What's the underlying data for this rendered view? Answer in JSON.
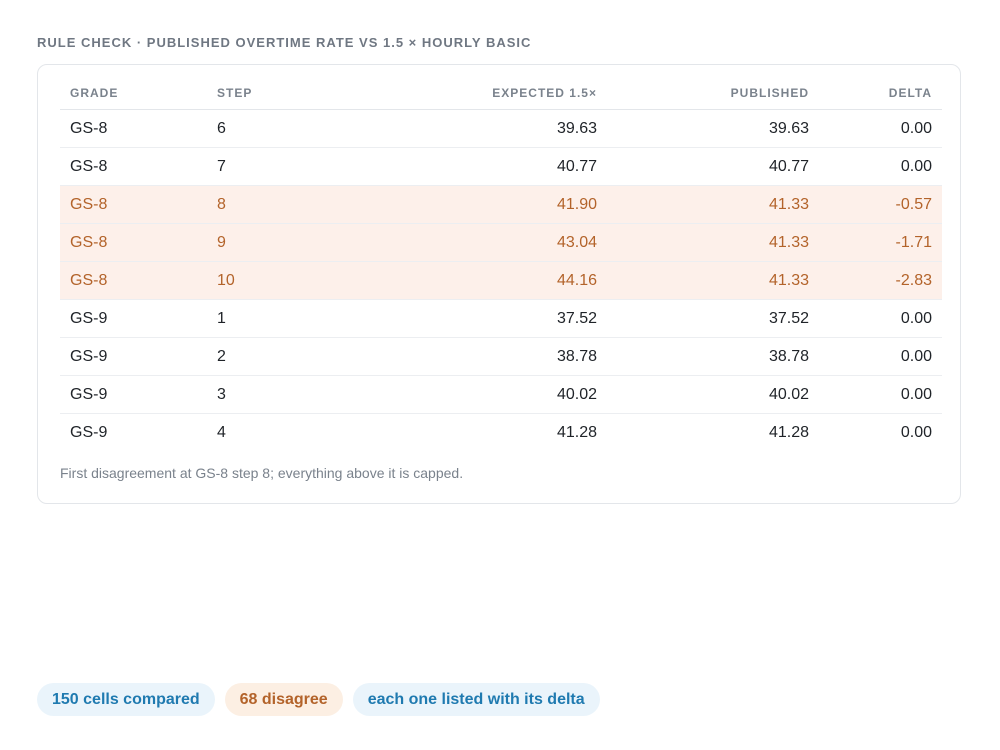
{
  "heading": "RULE CHECK · PUBLISHED OVERTIME RATE VS 1.5 × HOURLY BASIC",
  "table": {
    "columns": {
      "grade": "GRADE",
      "step": "STEP",
      "expected": "EXPECTED 1.5×",
      "published": "PUBLISHED",
      "delta": "DELTA"
    },
    "rows": [
      {
        "grade": "GS-8",
        "step": "6",
        "expected": "39.63",
        "published": "39.63",
        "delta": "0.00",
        "flagged": false
      },
      {
        "grade": "GS-8",
        "step": "7",
        "expected": "40.77",
        "published": "40.77",
        "delta": "0.00",
        "flagged": false
      },
      {
        "grade": "GS-8",
        "step": "8",
        "expected": "41.90",
        "published": "41.33",
        "delta": "-0.57",
        "flagged": true
      },
      {
        "grade": "GS-8",
        "step": "9",
        "expected": "43.04",
        "published": "41.33",
        "delta": "-1.71",
        "flagged": true
      },
      {
        "grade": "GS-8",
        "step": "10",
        "expected": "44.16",
        "published": "41.33",
        "delta": "-2.83",
        "flagged": true
      },
      {
        "grade": "GS-9",
        "step": "1",
        "expected": "37.52",
        "published": "37.52",
        "delta": "0.00",
        "flagged": false
      },
      {
        "grade": "GS-9",
        "step": "2",
        "expected": "38.78",
        "published": "38.78",
        "delta": "0.00",
        "flagged": false
      },
      {
        "grade": "GS-9",
        "step": "3",
        "expected": "40.02",
        "published": "40.02",
        "delta": "0.00",
        "flagged": false
      },
      {
        "grade": "GS-9",
        "step": "4",
        "expected": "41.28",
        "published": "41.28",
        "delta": "0.00",
        "flagged": false
      }
    ]
  },
  "note": "First disagreement at GS-8 step 8; everything above it is capped.",
  "chips": {
    "compared": "150 cells compared",
    "disagree": "68 disagree",
    "listed": "each one listed with its delta"
  },
  "colors": {
    "flag_background": "#fdf0ea",
    "flag_text": "#b3632a",
    "chip_blue_text": "#1f7ab0",
    "chip_orange_text": "#b3632a"
  }
}
